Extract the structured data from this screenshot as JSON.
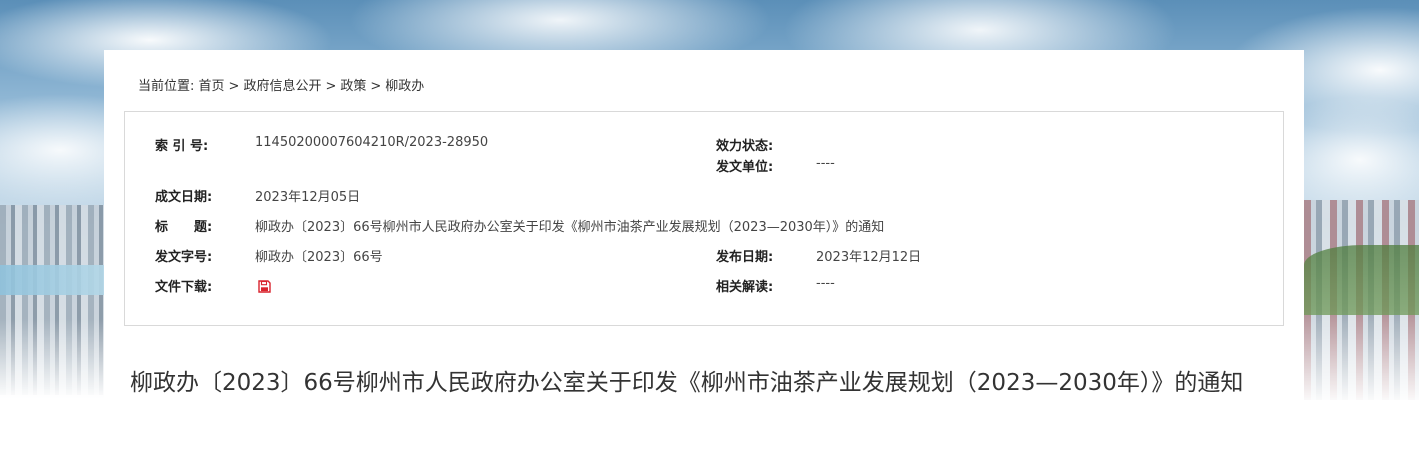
{
  "breadcrumb": {
    "prefix": "当前位置:",
    "items": [
      "首页",
      "政府信息公开",
      "政策",
      "柳政办"
    ],
    "separator": ">"
  },
  "info": {
    "index_label": "索 引 号:",
    "index_value": "11450200007604210R/2023-28950",
    "validity_label": "效力状态:",
    "validity_value": "",
    "issuer_label": "发文单位:",
    "issuer_value": "----",
    "date_written_label": "成文日期:",
    "date_written_value": "2023年12月05日",
    "title_label": "标　　题:",
    "title_value": "柳政办〔2023〕66号柳州市人民政府办公室关于印发《柳州市油茶产业发展规划（2023—2030年）》的通知",
    "doc_number_label": "发文字号:",
    "doc_number_value": "柳政办〔2023〕66号",
    "publish_date_label": "发布日期:",
    "publish_date_value": "2023年12月12日",
    "download_label": "文件下载:",
    "download_icon": "save-icon",
    "related_label": "相关解读:",
    "related_value": "----"
  },
  "document": {
    "title": "柳政办〔2023〕66号柳州市人民政府办公室关于印发《柳州市油茶产业发展规划（2023—2030年）》的通知"
  },
  "colors": {
    "icon_red": "#d9232d",
    "border": "#d9d9d9",
    "text": "#333333"
  }
}
